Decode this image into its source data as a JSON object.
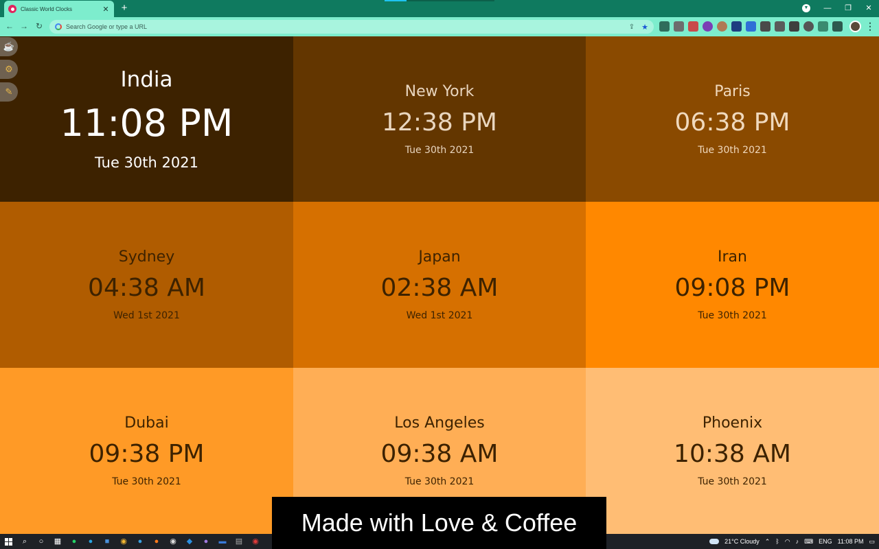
{
  "browser": {
    "tab_title": "Classic World Clocks",
    "tab_close": "✕",
    "new_tab": "+",
    "omnibox_placeholder": "Search Google or type a URL",
    "win_minimize": "—",
    "win_restore": "❐",
    "win_close": "✕"
  },
  "clocks": [
    {
      "city": "India",
      "time": "11:08 PM",
      "date": "Tue 30th 2021",
      "bg": "#3d2200",
      "fg": "#ffffff"
    },
    {
      "city": "New York",
      "time": "12:38 PM",
      "date": "Tue 30th 2021",
      "bg": "#633600",
      "fg": "#e9d6bf"
    },
    {
      "city": "Paris",
      "time": "06:38 PM",
      "date": "Tue 30th 2021",
      "bg": "#8a4a00",
      "fg": "#f0d9bd"
    },
    {
      "city": "Sydney",
      "time": "04:38 AM",
      "date": "Wed 1st 2021",
      "bg": "#b05c00",
      "fg": "#3d2200"
    },
    {
      "city": "Japan",
      "time": "02:38 AM",
      "date": "Wed 1st 2021",
      "bg": "#d67000",
      "fg": "#3d2200"
    },
    {
      "city": "Iran",
      "time": "09:08 PM",
      "date": "Tue 30th 2021",
      "bg": "#ff8800",
      "fg": "#3d2200"
    },
    {
      "city": "Dubai",
      "time": "09:38 PM",
      "date": "Tue 30th 2021",
      "bg": "#ff9a26",
      "fg": "#3d2200"
    },
    {
      "city": "Los Angeles",
      "time": "09:38 AM",
      "date": "Tue 30th 2021",
      "bg": "#ffae55",
      "fg": "#3d2200"
    },
    {
      "city": "Phoenix",
      "time": "10:38 AM",
      "date": "Tue 30th 2021",
      "bg": "#ffbd74",
      "fg": "#3d2200"
    }
  ],
  "side_buttons": [
    {
      "name": "coffee-button",
      "icon": "coffee-icon",
      "glyph": "☕"
    },
    {
      "name": "settings-button",
      "icon": "gear-icon",
      "glyph": "⚙"
    },
    {
      "name": "edit-button",
      "icon": "pencil-icon",
      "glyph": "✎"
    }
  ],
  "banner": "Made with Love & Coffee",
  "taskbar": {
    "weather": "21°C  Cloudy",
    "language": "ENG",
    "clock": "11:08 PM"
  }
}
